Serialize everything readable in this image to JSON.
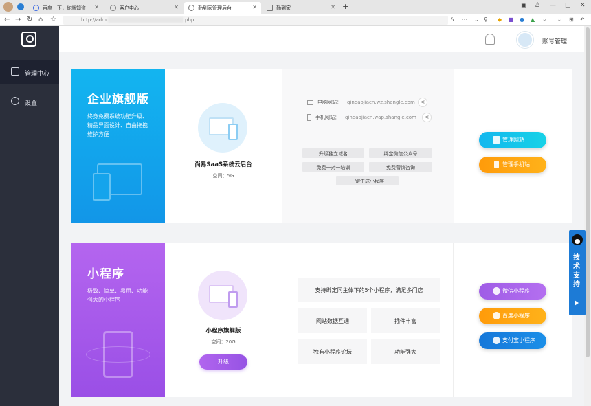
{
  "browser": {
    "tabs": [
      {
        "label": "百度一下，你就知道"
      },
      {
        "label": "客户中心"
      },
      {
        "label": "勤到家管理后台"
      },
      {
        "label": "勤到家"
      }
    ],
    "new_tab": "+",
    "url_prefix": "http://adm",
    "url_suffix": "php",
    "window_controls": [
      "—",
      "□",
      "✕"
    ]
  },
  "sidebar": {
    "items": [
      {
        "label": "管理中心",
        "icon": "dashboard-icon"
      },
      {
        "label": "设置",
        "icon": "gear-icon"
      }
    ]
  },
  "header": {
    "account_label": "账号管理"
  },
  "enterprise": {
    "banner_title": "企业旗舰版",
    "banner_desc": "终身免费系统功能升级、精品界面设计、自由拖拽维护方便",
    "plan_name": "尚易SaaS系统云后台",
    "plan_space": "空间：5G",
    "pc_site_label": "电脑网站：",
    "pc_site_url": "qindaojiacn.wz.shangle.com",
    "mobile_site_label": "手机网站：",
    "mobile_site_url": "qindaojiacn.wap.shangle.com",
    "chips": [
      "升级独立域名",
      "绑定微信公众号",
      "免费一对一培训",
      "免费营销咨询",
      "一键生成小程序"
    ],
    "buttons": [
      "管理网站",
      "管理手机站"
    ]
  },
  "miniapp": {
    "banner_title": "小程序",
    "banner_desc": "极致、简单、易用、功能强大的小程序",
    "plan_name": "小程序旗舰版",
    "plan_space": "空间：20G",
    "upgrade_label": "升级",
    "feature_main": "支持绑定同主体下的5个小程序，满足多门店",
    "features": [
      "网站数据互通",
      "插件丰富",
      "独有小程序论坛",
      "功能强大"
    ],
    "buttons": [
      "微信小程序",
      "百度小程序",
      "支付宝小程序"
    ]
  },
  "support": {
    "label": "技术支持"
  },
  "colors": {
    "enterprise_blue": "#13b5f0",
    "miniapp_purple": "#a85be9",
    "sidebar_bg": "#2b2f3b",
    "button_cyan": "#14b7ee",
    "button_orange": "#ff9b0a",
    "button_purple": "#9f5ce6",
    "button_blue": "#1677d9",
    "support_blue": "#1d7bd6"
  }
}
